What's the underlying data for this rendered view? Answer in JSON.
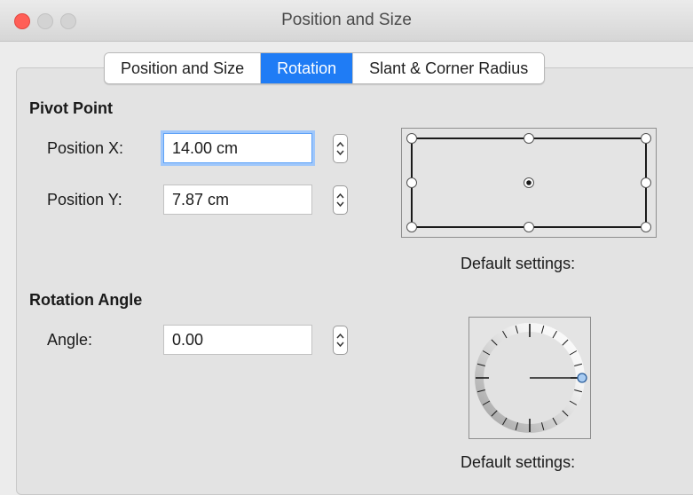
{
  "window": {
    "title": "Position and Size"
  },
  "tabs": [
    {
      "label": "Position and Size",
      "active": false
    },
    {
      "label": "Rotation",
      "active": true
    },
    {
      "label": "Slant & Corner Radius",
      "active": false
    }
  ],
  "pivot": {
    "section_title": "Pivot Point",
    "position_x_label": "Position X:",
    "position_x_value": "14.00 cm",
    "position_y_label": "Position Y:",
    "position_y_value": "7.87 cm",
    "caption": "Default settings:"
  },
  "rotation": {
    "section_title": "Rotation Angle",
    "angle_label": "Angle:",
    "angle_value": "0.00",
    "caption": "Default settings:"
  },
  "colors": {
    "accent": "#1f7cf5",
    "close": "#ff5f57",
    "knob": "#a9ccf2"
  }
}
